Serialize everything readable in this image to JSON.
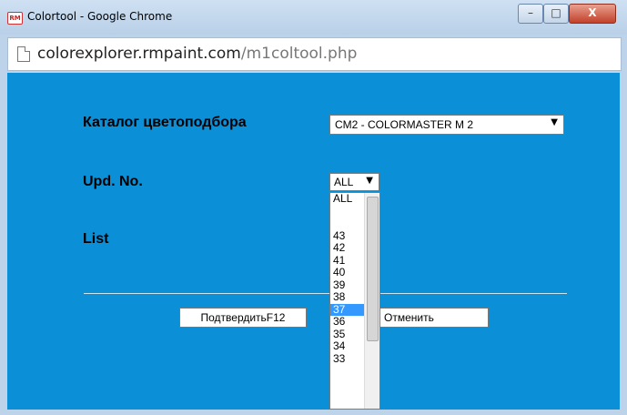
{
  "window": {
    "title": "Colortool - Google Chrome",
    "app_icon_text": "RM",
    "minimize_label": "–",
    "maximize_label": "□",
    "close_label": "X"
  },
  "address": {
    "host": "colorexplorer.rmpaint.com",
    "path": "/m1coltool.php"
  },
  "form": {
    "catalog_label": "Каталог цветоподбора",
    "catalog_value": "CM2 - COLORMASTER M 2",
    "upd_label": "Upd. No.",
    "upd_value": "ALL",
    "list_label": "List",
    "dropdown_arrow": "▼",
    "confirm_label": "ПодтвердитьF12",
    "cancel_label": "Отменить"
  },
  "dropdown": {
    "options": [
      "ALL",
      "",
      "43",
      "42",
      "41",
      "40",
      "39",
      "38",
      "37",
      "36",
      "35",
      "34",
      "33"
    ],
    "selected": "37"
  }
}
